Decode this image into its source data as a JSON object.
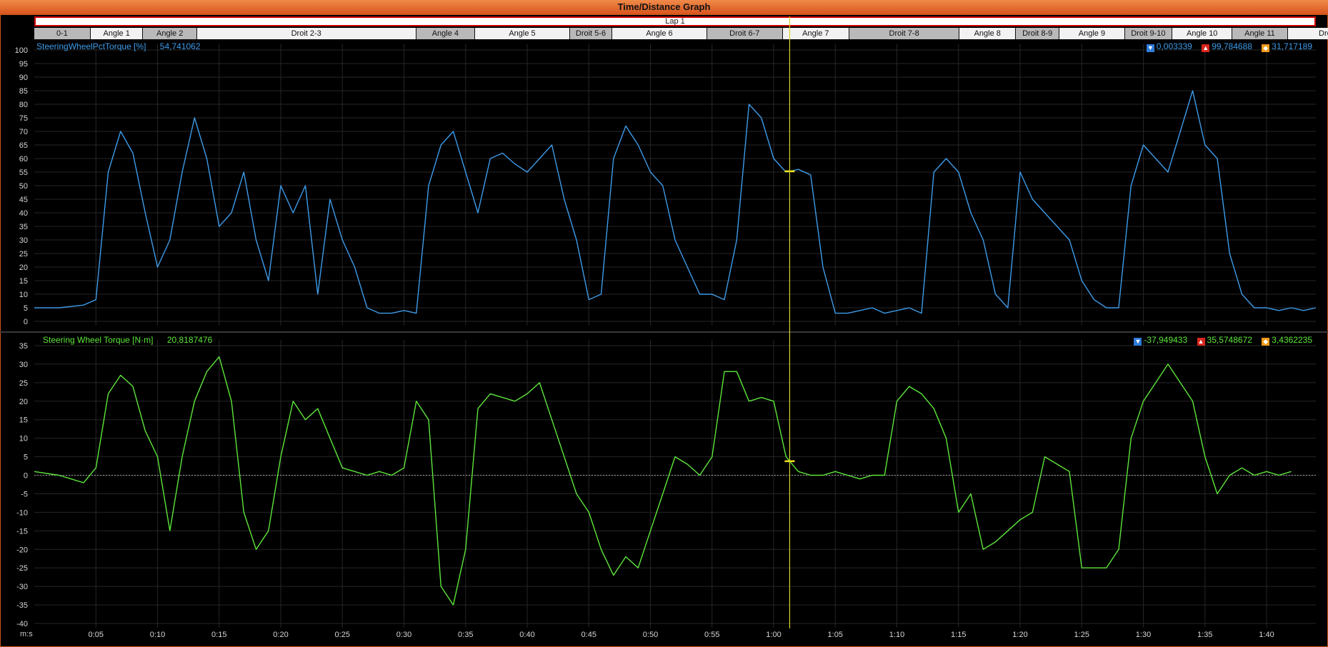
{
  "window": {
    "title": "Time/Distance Graph"
  },
  "lap": {
    "label": "Lap 1"
  },
  "segments": [
    {
      "label": "0-1",
      "w": 0.044,
      "style": "mid"
    },
    {
      "label": "Angle 1",
      "w": 0.041,
      "style": "light"
    },
    {
      "label": "Angle 2",
      "w": 0.042,
      "style": "mid"
    },
    {
      "label": "Droit 2-3",
      "w": 0.171,
      "style": "light"
    },
    {
      "label": "Angle 4",
      "w": 0.046,
      "style": "mid"
    },
    {
      "label": "Angle 5",
      "w": 0.074,
      "style": "light"
    },
    {
      "label": "Droit 5-6",
      "w": 0.033,
      "style": "mid"
    },
    {
      "label": "Angle 6",
      "w": 0.074,
      "style": "light"
    },
    {
      "label": "Droit 6-7",
      "w": 0.059,
      "style": "mid"
    },
    {
      "label": "Angle 7",
      "w": 0.052,
      "style": "light"
    },
    {
      "label": "Droit 7-8",
      "w": 0.086,
      "style": "mid"
    },
    {
      "label": "Angle 8",
      "w": 0.044,
      "style": "light"
    },
    {
      "label": "Droit 8-9",
      "w": 0.034,
      "style": "mid"
    },
    {
      "label": "Angle 9",
      "w": 0.051,
      "style": "light"
    },
    {
      "label": "Droit 9-10",
      "w": 0.037,
      "style": "mid"
    },
    {
      "label": "Angle 10",
      "w": 0.047,
      "style": "light"
    },
    {
      "label": "Angle 11",
      "w": 0.043,
      "style": "mid"
    },
    {
      "label": "Droit",
      "w": 0.062,
      "style": "light"
    }
  ],
  "chart_data": [
    {
      "type": "line",
      "series": [
        {
          "name": "SteeringWheelPctTorque [%]",
          "color": "#3d9be9"
        }
      ],
      "cursor_value": "54,741062",
      "stats": {
        "min": "0,003339",
        "max": "99,784688",
        "avg": "31,717189"
      },
      "ylim": [
        0,
        100
      ],
      "yticks": [
        0,
        5,
        10,
        15,
        20,
        25,
        30,
        35,
        40,
        45,
        50,
        55,
        60,
        65,
        70,
        75,
        80,
        85,
        90,
        95,
        100
      ],
      "x": [
        0,
        2,
        4,
        5,
        6,
        7,
        8,
        9,
        10,
        11,
        12,
        13,
        14,
        15,
        16,
        17,
        18,
        19,
        20,
        21,
        22,
        23,
        24,
        25,
        26,
        27,
        28,
        29,
        30,
        31,
        32,
        33,
        34,
        35,
        36,
        37,
        38,
        39,
        40,
        41,
        42,
        43,
        44,
        45,
        46,
        47,
        48,
        49,
        50,
        51,
        52,
        53,
        54,
        55,
        56,
        57,
        58,
        59,
        60,
        61,
        62,
        63,
        64,
        65,
        66,
        67,
        68,
        69,
        70,
        71,
        72,
        73,
        74,
        75,
        76,
        77,
        78,
        79,
        80,
        81,
        82,
        83,
        84,
        85,
        86,
        87,
        88,
        89,
        90,
        91,
        92,
        93,
        94,
        95,
        96,
        97,
        98,
        99,
        100,
        101,
        102,
        103,
        104
      ],
      "values": [
        5,
        5,
        6,
        8,
        55,
        70,
        62,
        40,
        20,
        30,
        55,
        75,
        60,
        35,
        40,
        55,
        30,
        15,
        50,
        40,
        50,
        10,
        45,
        30,
        20,
        5,
        3,
        3,
        4,
        3,
        50,
        65,
        70,
        55,
        40,
        60,
        62,
        58,
        55,
        60,
        65,
        45,
        30,
        8,
        10,
        60,
        72,
        65,
        55,
        50,
        30,
        20,
        10,
        10,
        8,
        30,
        80,
        75,
        60,
        55,
        56,
        54,
        20,
        3,
        3,
        4,
        5,
        3,
        4,
        5,
        3,
        55,
        60,
        55,
        40,
        30,
        10,
        5,
        55,
        45,
        40,
        35,
        30,
        15,
        8,
        5,
        5,
        50,
        65,
        60,
        55,
        70,
        85,
        65,
        60,
        25,
        10,
        5,
        5,
        4,
        5,
        4,
        5
      ],
      "unit": "%"
    },
    {
      "type": "line",
      "series": [
        {
          "name": "Steering Wheel Torque [N·m]",
          "color": "#5de63a"
        }
      ],
      "cursor_value": "20,8187476",
      "stats": {
        "min": "-37,949433",
        "max": "35,5748672",
        "avg": "3,4362235"
      },
      "ylim": [
        -40,
        35
      ],
      "yticks": [
        -40,
        -35,
        -30,
        -25,
        -20,
        -15,
        -10,
        -5,
        0,
        5,
        10,
        15,
        20,
        25,
        30,
        35
      ],
      "x": [
        0,
        2,
        4,
        5,
        6,
        7,
        8,
        9,
        10,
        11,
        12,
        13,
        14,
        15,
        16,
        17,
        18,
        19,
        20,
        21,
        22,
        23,
        24,
        25,
        26,
        27,
        28,
        29,
        30,
        31,
        32,
        33,
        34,
        35,
        36,
        37,
        38,
        39,
        40,
        41,
        42,
        43,
        44,
        45,
        46,
        47,
        48,
        49,
        50,
        51,
        52,
        53,
        54,
        55,
        56,
        57,
        58,
        59,
        60,
        61,
        62,
        63,
        64,
        65,
        66,
        67,
        68,
        69,
        70,
        71,
        72,
        73,
        74,
        75,
        76,
        77,
        78,
        79,
        80,
        81,
        82,
        83,
        84,
        85,
        86,
        87,
        88,
        89,
        90,
        91,
        92,
        93,
        94,
        95,
        96,
        97,
        98,
        99,
        100,
        101,
        102,
        103,
        104
      ],
      "values": [
        1,
        0,
        -2,
        2,
        22,
        27,
        24,
        12,
        5,
        -15,
        5,
        20,
        28,
        32,
        20,
        -10,
        -20,
        -15,
        5,
        20,
        15,
        18,
        10,
        2,
        1,
        0,
        1,
        0,
        2,
        20,
        15,
        -30,
        -35,
        -20,
        18,
        22,
        21,
        20,
        22,
        25,
        15,
        5,
        -5,
        -10,
        -20,
        -27,
        -22,
        -25,
        -15,
        -5,
        5,
        3,
        0,
        5,
        28,
        28,
        20,
        21,
        20,
        5,
        1,
        0,
        0,
        1,
        0,
        -1,
        0,
        0,
        20,
        24,
        22,
        18,
        10,
        -10,
        -5,
        -20,
        -18,
        -15,
        -12,
        -10,
        5,
        3,
        1,
        -25,
        -25,
        -25,
        -20,
        10,
        20,
        25,
        30,
        25,
        20,
        5,
        -5,
        0,
        2,
        0,
        1,
        0,
        1
      ],
      "unit": "N·m"
    }
  ],
  "x_axis": {
    "unit_label": "m:s",
    "ticks": [
      "0:05",
      "0:10",
      "0:15",
      "0:20",
      "0:25",
      "0:30",
      "0:35",
      "0:40",
      "0:45",
      "0:50",
      "0:55",
      "1:00",
      "1:05",
      "1:10",
      "1:15",
      "1:20",
      "1:25",
      "1:30",
      "1:35",
      "1:40"
    ],
    "tick_seconds": [
      5,
      10,
      15,
      20,
      25,
      30,
      35,
      40,
      45,
      50,
      55,
      60,
      65,
      70,
      75,
      80,
      85,
      90,
      95,
      100
    ],
    "xlim": [
      0,
      104
    ],
    "cursor_seconds": 61.3
  }
}
